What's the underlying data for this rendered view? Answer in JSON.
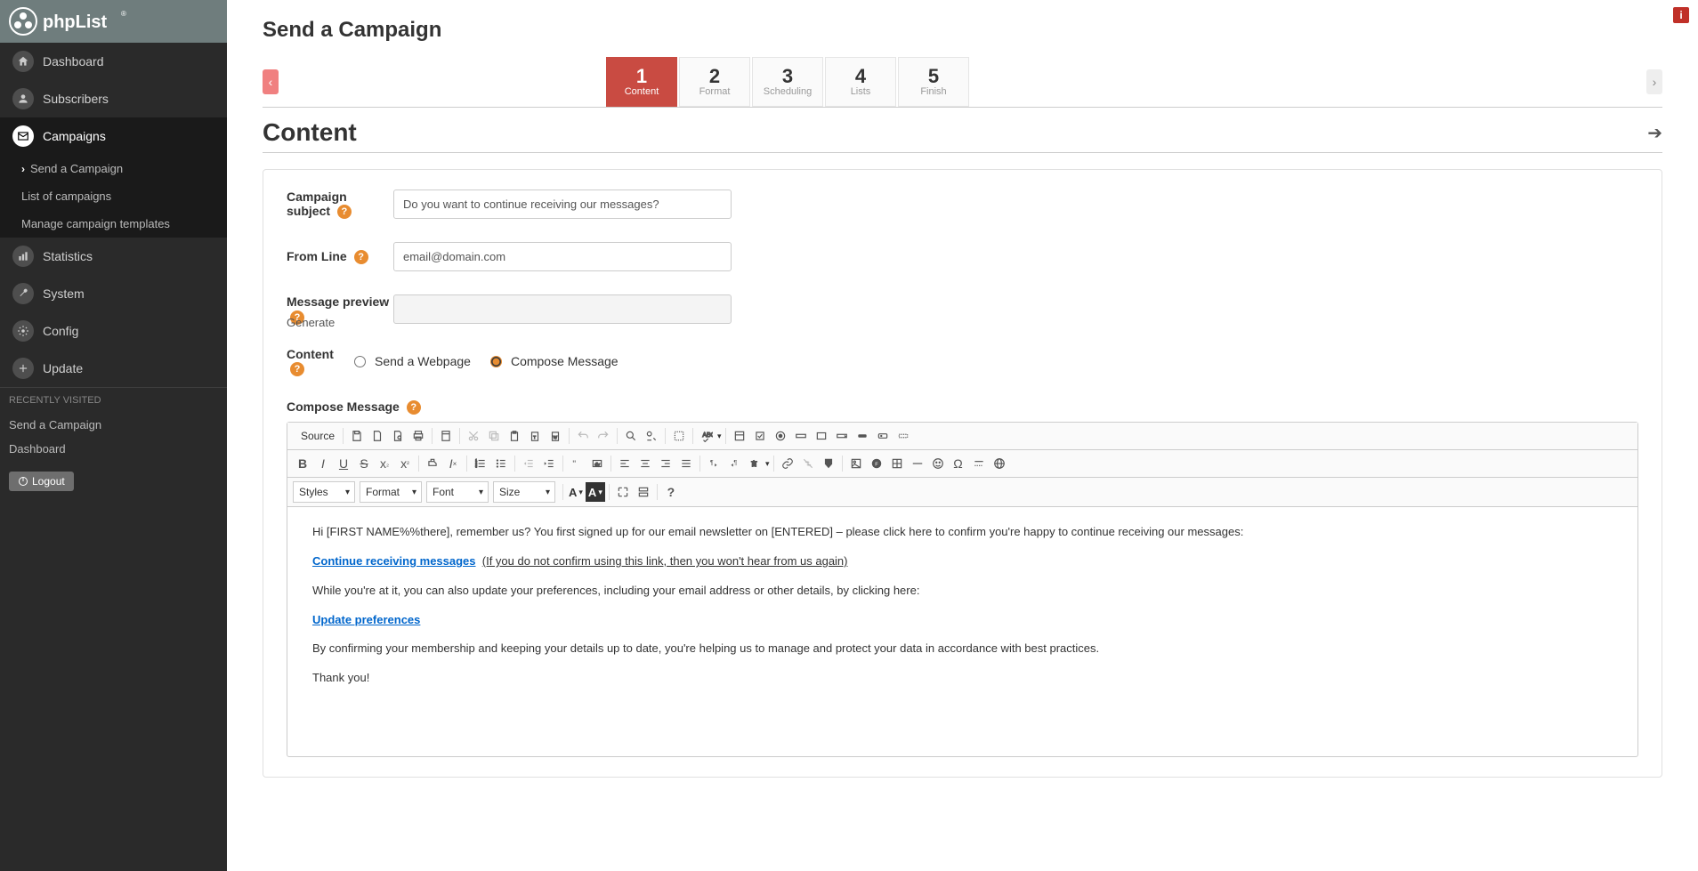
{
  "app": {
    "name": "phpList"
  },
  "sidebar": {
    "items": [
      {
        "label": "Dashboard",
        "icon": "home"
      },
      {
        "label": "Subscribers",
        "icon": "user"
      },
      {
        "label": "Campaigns",
        "icon": "mail",
        "active": true
      },
      {
        "label": "Statistics",
        "icon": "stats"
      },
      {
        "label": "System",
        "icon": "wrench"
      },
      {
        "label": "Config",
        "icon": "gear"
      },
      {
        "label": "Update",
        "icon": "plus"
      }
    ],
    "campaigns_sub": [
      {
        "label": "Send a Campaign",
        "chev": true
      },
      {
        "label": "List of campaigns"
      },
      {
        "label": "Manage campaign templates"
      }
    ],
    "recent_header": "RECENTLY VISITED",
    "recent": [
      {
        "label": "Send a Campaign"
      },
      {
        "label": "Dashboard"
      }
    ],
    "logout": "Logout"
  },
  "page": {
    "title": "Send a Campaign",
    "section": "Content",
    "steps": [
      {
        "num": "1",
        "label": "Content",
        "active": true
      },
      {
        "num": "2",
        "label": "Format"
      },
      {
        "num": "3",
        "label": "Scheduling"
      },
      {
        "num": "4",
        "label": "Lists"
      },
      {
        "num": "5",
        "label": "Finish"
      }
    ]
  },
  "form": {
    "subject_label": "Campaign subject",
    "subject_value": "Do you want to continue receiving our messages?",
    "from_label": "From Line",
    "from_value": "email@domain.com",
    "preview_label": "Message preview",
    "preview_value": "",
    "generate": "Generate",
    "content_label": "Content",
    "radio_webpage": "Send a Webpage",
    "radio_compose": "Compose Message",
    "compose_label": "Compose Message"
  },
  "toolbar": {
    "source": "Source",
    "styles": "Styles",
    "format": "Format",
    "font": "Font",
    "size": "Size"
  },
  "editor": {
    "p1": "Hi [FIRST NAME%%there], remember us? You first signed up for our email newsletter on [ENTERED] – please click here to confirm you're happy to continue receiving our messages:",
    "link1": "Continue receiving messages",
    "link1_paren": "(If you do not confirm using this link, then you won't hear from us again)",
    "p2": "While you're at it, you can also update your preferences, including your email address or other details, by clicking here:",
    "link2": "Update preferences",
    "p3": "By confirming your membership and keeping your details up to date, you're helping us to manage and protect your data in accordance with best practices.",
    "p4": "Thank you!"
  }
}
